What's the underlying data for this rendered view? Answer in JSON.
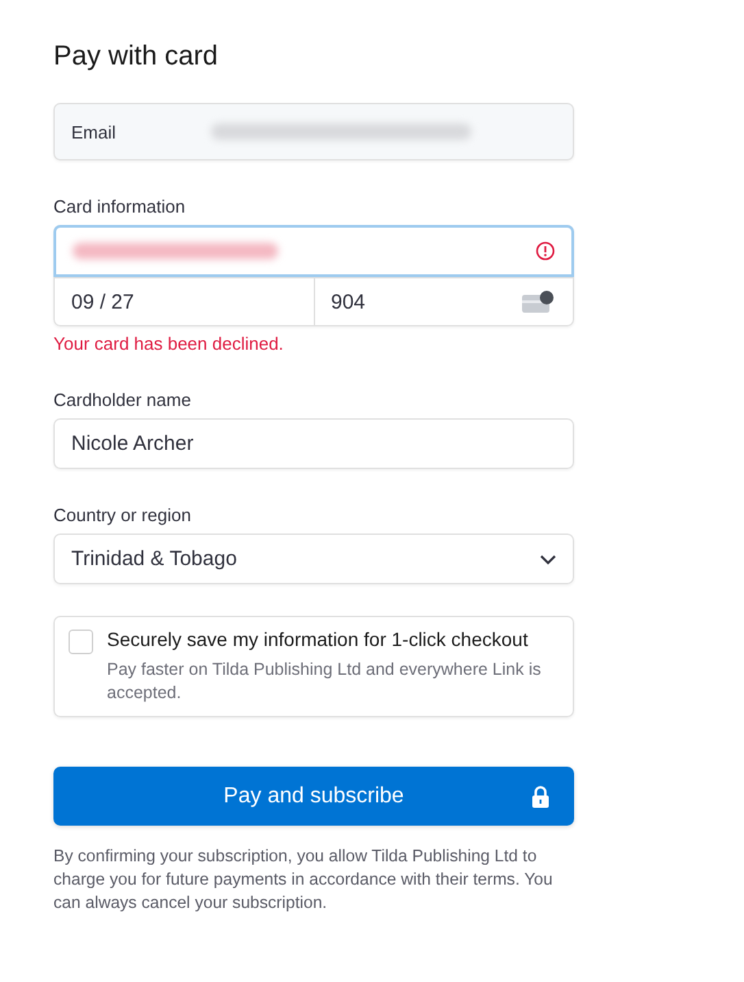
{
  "title": "Pay with card",
  "email": {
    "label": "Email"
  },
  "card": {
    "label": "Card information",
    "number_error": true,
    "expiry": "09 / 27",
    "cvc": "904",
    "error_message": "Your card has been declined."
  },
  "cardholder": {
    "label": "Cardholder name",
    "value": "Nicole Archer"
  },
  "country": {
    "label": "Country or region",
    "value": "Trinidad & Tobago"
  },
  "save": {
    "checked": false,
    "title": "Securely save my information for 1-click checkout",
    "description": "Pay faster on Tilda Publishing Ltd and everywhere Link is accepted."
  },
  "submit": {
    "label": "Pay and subscribe"
  },
  "footer": "By confirming your subscription, you allow Tilda Publishing Ltd to charge you for future payments in accordance with their terms. You can always cancel your subscription."
}
